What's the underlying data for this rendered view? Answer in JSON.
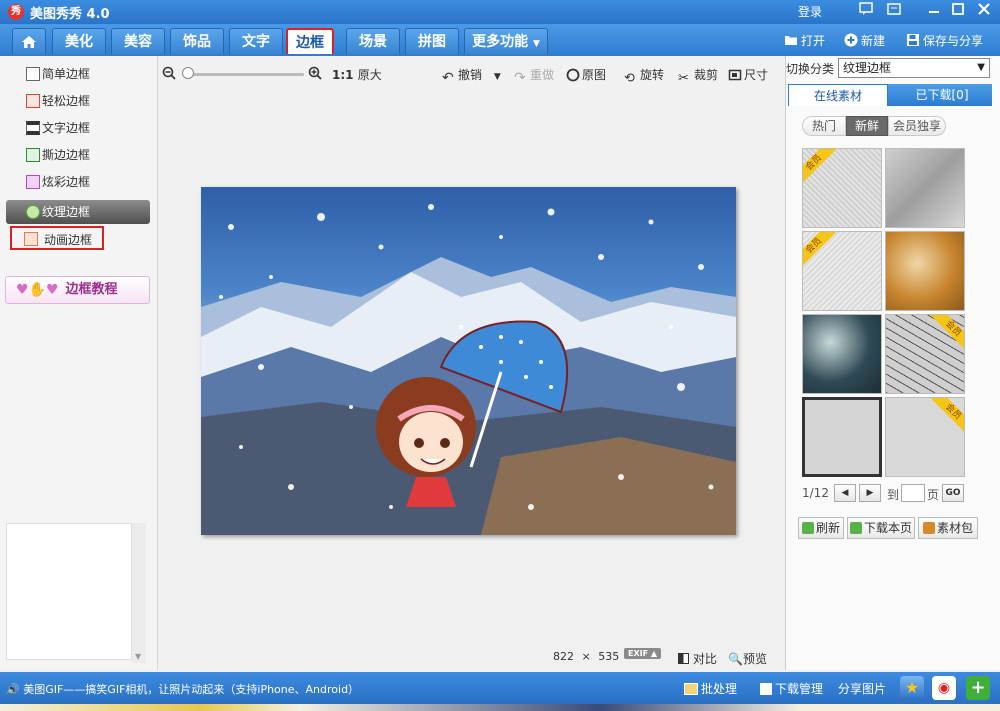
{
  "titlebar": {
    "logo_text": "秀",
    "title": "美图秀秀 4.0",
    "login": "登录"
  },
  "nav": {
    "tabs": [
      "美化",
      "美容",
      "饰品",
      "文字",
      "边框",
      "场景",
      "拼图",
      "更多功能"
    ],
    "active": "边框",
    "right_actions": [
      "打开",
      "新建",
      "保存与分享"
    ]
  },
  "left": {
    "items": [
      "简单边框",
      "轻松边框",
      "文字边框",
      "撕边边框",
      "炫彩边框",
      "纹理边框",
      "动画边框"
    ],
    "active": "纹理边框",
    "highlighted": "动画边框",
    "tutorial": "边框教程"
  },
  "toolbar": {
    "zoom_ratio": "1:1",
    "original_size": "原大",
    "undo": "撤销",
    "redo": "重做",
    "original": "原图",
    "rotate": "旋转",
    "crop": "裁剪",
    "size": "尺寸"
  },
  "canvas": {
    "width": "822",
    "times": "×",
    "height": "535",
    "exif": "EXIF",
    "compare": "对比",
    "preview": "预览"
  },
  "right": {
    "switch_label": "切换分类",
    "category": "纹理边框",
    "tabs": [
      "在线素材",
      "已下载[0]"
    ],
    "filters": [
      "热门",
      "新鲜",
      "会员独享"
    ],
    "active_filter": "新鲜",
    "member_badge": "会员",
    "pager": {
      "page": "1/12",
      "to": "到",
      "page_unit": "页",
      "go": "GO"
    },
    "actions": [
      "刷新",
      "下载本页",
      "素材包"
    ]
  },
  "bottom": {
    "message": "美图GIF——搞笑GIF相机，让照片动起来（支持iPhone、Android）",
    "items": [
      "批处理",
      "下载管理",
      "分享图片"
    ]
  },
  "colors": {
    "chrome_blue": "#2f7cd0",
    "highlight_red": "#e02020",
    "member_gold": "#f5c518"
  }
}
